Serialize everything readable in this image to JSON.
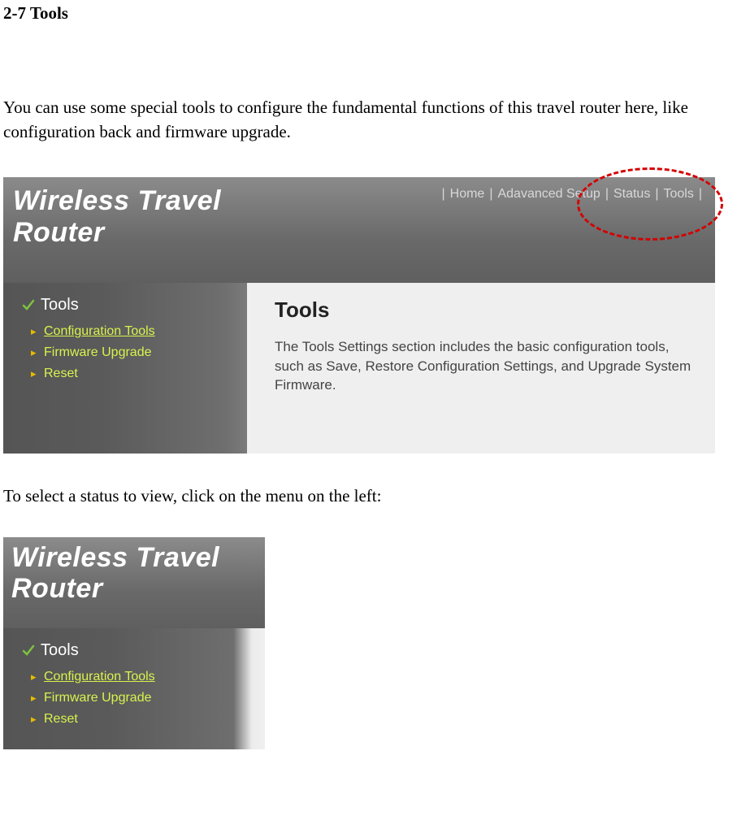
{
  "doc": {
    "section_heading": "2-7 Tools",
    "intro": "You can use some special tools to configure the fundamental functions of this travel router here, like configuration back and firmware upgrade.",
    "mid_text": "To select a status to view, click on the menu on the left:"
  },
  "router1": {
    "logo_line1": "Wireless Travel",
    "logo_line2": "Router",
    "nav": {
      "home": "Home",
      "advanced": "Adavanced Setup",
      "status": "Status",
      "tools": "Tools"
    },
    "sidebar": {
      "heading": "Tools",
      "items": [
        {
          "label": "Configuration Tools"
        },
        {
          "label": "Firmware Upgrade"
        },
        {
          "label": "Reset"
        }
      ]
    },
    "content": {
      "heading": "Tools",
      "text": "The Tools Settings section includes the basic configuration tools, such as Save, Restore Configuration Settings, and Upgrade System Firmware."
    }
  },
  "router2": {
    "logo_line1": "Wireless Travel",
    "logo_line2": "Router",
    "sidebar": {
      "heading": "Tools",
      "items": [
        {
          "label": "Configuration Tools"
        },
        {
          "label": "Firmware Upgrade"
        },
        {
          "label": "Reset"
        }
      ]
    }
  }
}
